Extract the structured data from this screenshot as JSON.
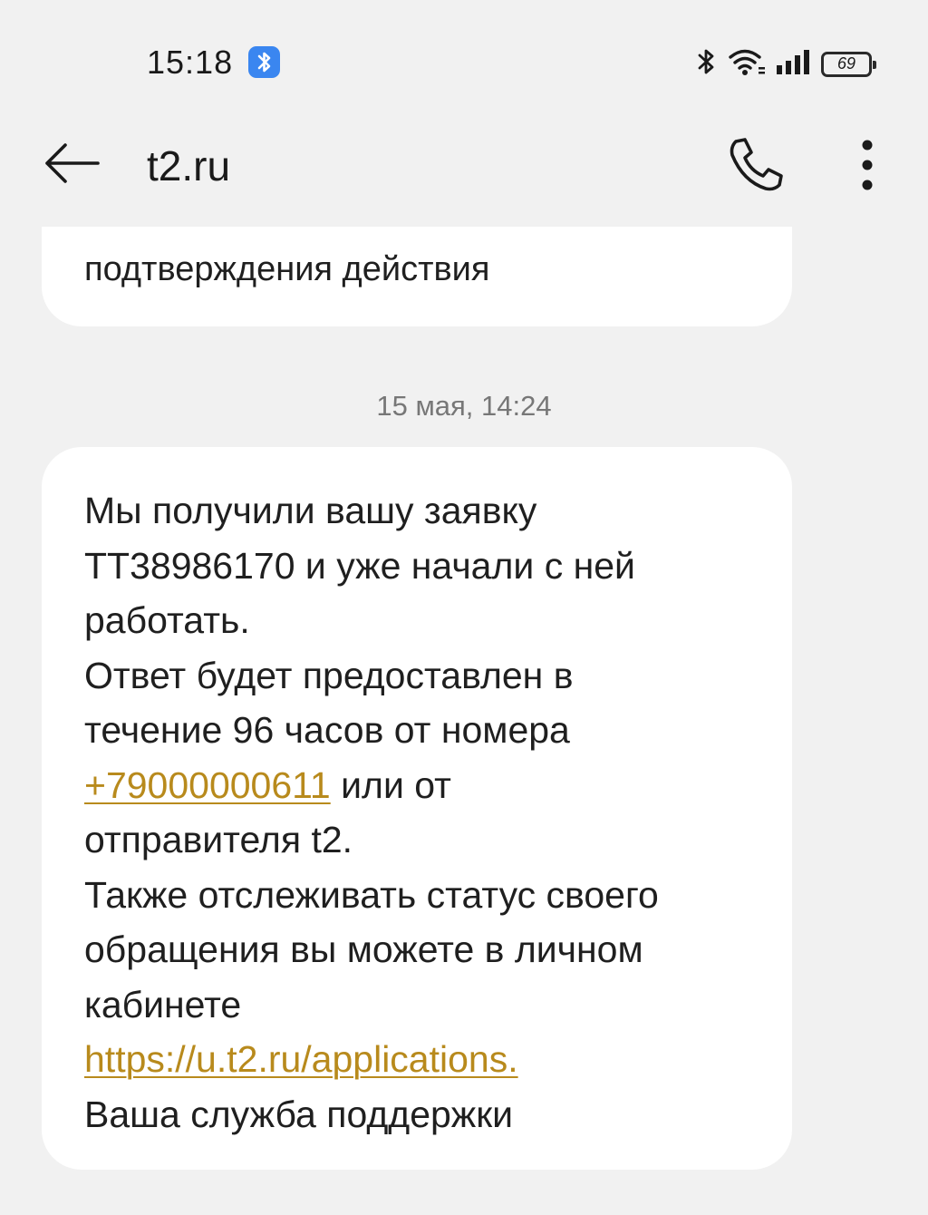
{
  "status_bar": {
    "time": "15:18",
    "battery_level": "69",
    "icons": [
      "bluetooth-badge-icon",
      "bluetooth-icon",
      "wifi-icon",
      "signal-icon",
      "battery-icon"
    ]
  },
  "header": {
    "title": "t2.ru",
    "icons": [
      "back-arrow-icon",
      "phone-icon",
      "more-vert-icon"
    ]
  },
  "messages": {
    "prev_bubble_tail": "подтверждения действия",
    "timestamp": "15 мая, 14:24",
    "main": {
      "line1": "Мы получили вашу заявку",
      "line2": "ТТ38986170 и уже начали с ней",
      "line3": "работать.",
      "line4": "Ответ будет предоставлен в",
      "line5": "течение 96 часов от номера",
      "phone_link": "+79000000611",
      "line6_rest": " или от",
      "line7": "отправителя t2.",
      "line8": "Также отслеживать статус своего",
      "line9": "обращения вы можете в личном",
      "line10": "кабинете",
      "url_link": "https://u.t2.ru/applications.",
      "line12": "Ваша служба поддержки"
    }
  },
  "colors": {
    "background": "#f1f1f1",
    "bubble": "#ffffff",
    "link": "#b88a1c",
    "bluetooth_badge": "#3a86f0"
  }
}
